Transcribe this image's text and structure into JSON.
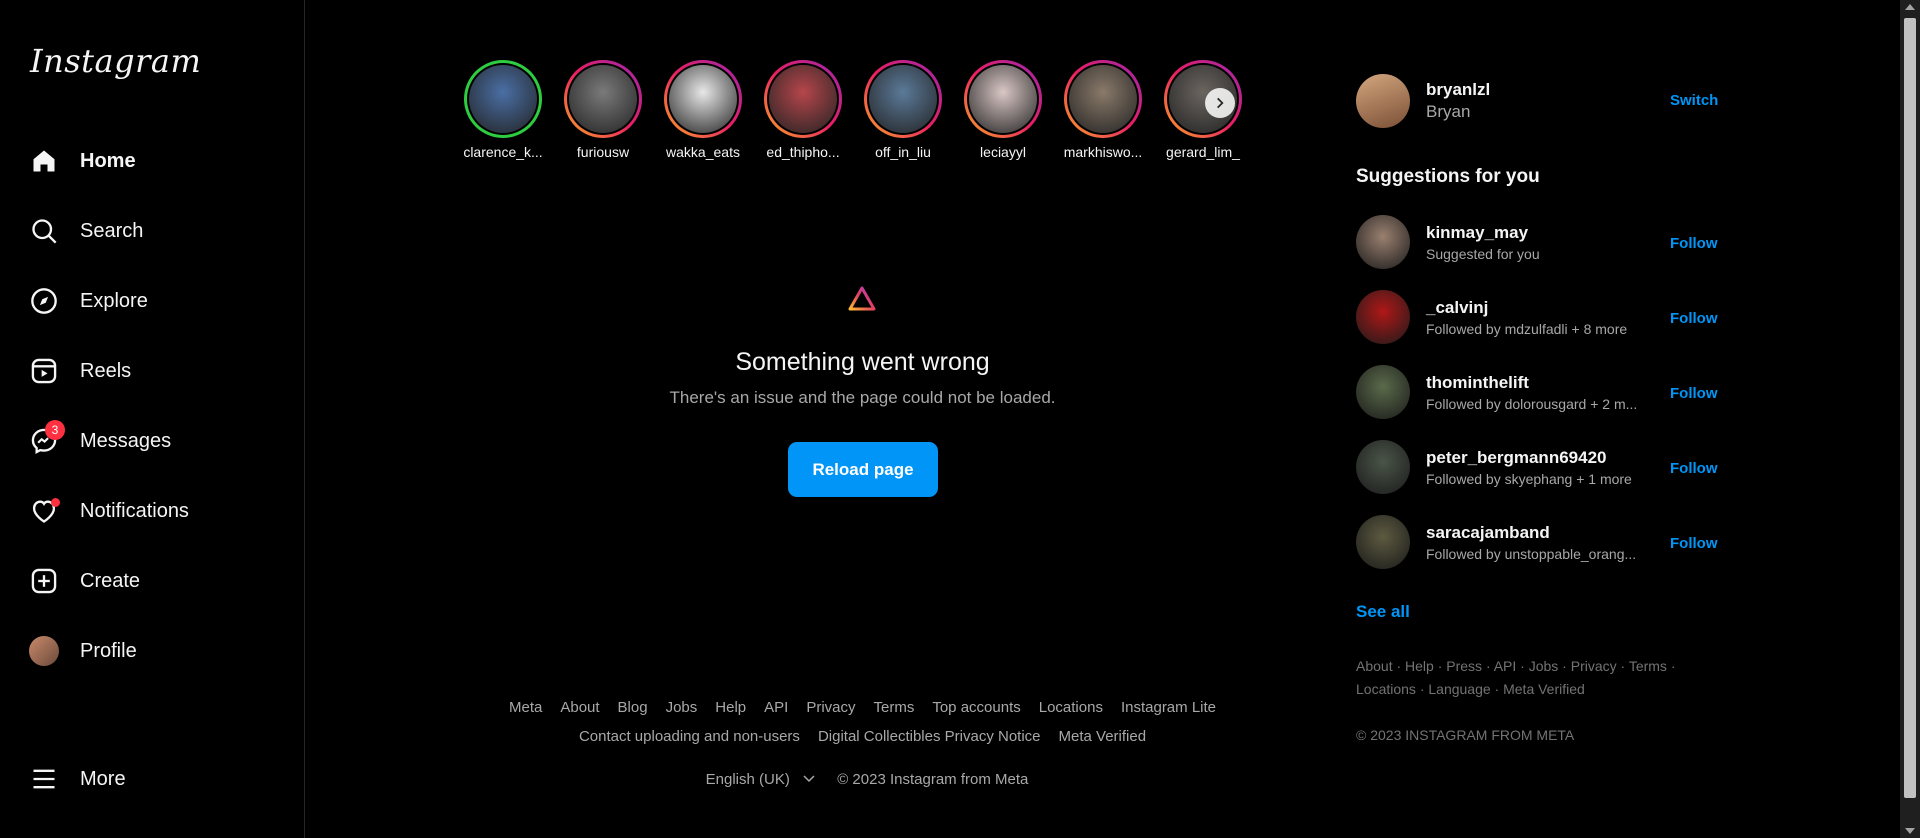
{
  "app": {
    "logo": "Instagram"
  },
  "sidebar": {
    "items": [
      {
        "label": "Home",
        "icon": "home-icon",
        "active": true
      },
      {
        "label": "Search",
        "icon": "search-icon"
      },
      {
        "label": "Explore",
        "icon": "compass-icon"
      },
      {
        "label": "Reels",
        "icon": "reels-icon"
      },
      {
        "label": "Messages",
        "icon": "messenger-icon",
        "badge": "3"
      },
      {
        "label": "Notifications",
        "icon": "heart-icon",
        "dot": true
      },
      {
        "label": "Create",
        "icon": "plus-square-icon"
      },
      {
        "label": "Profile",
        "icon": "avatar"
      }
    ],
    "more": {
      "label": "More",
      "icon": "hamburger-icon"
    }
  },
  "stories": [
    {
      "name": "clarence_k...",
      "color": "#4a6fa5",
      "seen_ring": "green"
    },
    {
      "name": "furiousw",
      "color": "#7a7a7a"
    },
    {
      "name": "wakka_eats",
      "color": "#e8e8e8"
    },
    {
      "name": "ed_thipho...",
      "color": "#b5464b"
    },
    {
      "name": "off_in_liu",
      "color": "#5b7a99"
    },
    {
      "name": "leciayyl",
      "color": "#d9c7c5"
    },
    {
      "name": "markhiswo...",
      "color": "#8a7a6a"
    },
    {
      "name": "gerard_lim_",
      "color": "#6b6560"
    }
  ],
  "error": {
    "title": "Something went wrong",
    "subtitle": "There's an issue and the page could not be loaded.",
    "button": "Reload page"
  },
  "footer": {
    "row1": [
      "Meta",
      "About",
      "Blog",
      "Jobs",
      "Help",
      "API",
      "Privacy",
      "Terms",
      "Top accounts",
      "Locations",
      "Instagram Lite"
    ],
    "row2": [
      "Contact uploading and non-users",
      "Digital Collectibles Privacy Notice",
      "Meta Verified"
    ],
    "language": "English (UK)",
    "copyright": "© 2023 Instagram from Meta"
  },
  "account": {
    "username": "bryanlzl",
    "name": "Bryan",
    "switch": "Switch"
  },
  "suggestions": {
    "title": "Suggestions for you",
    "follow_label": "Follow",
    "items": [
      {
        "username": "kinmay_may",
        "sub": "Suggested for you",
        "color": "#9a8070"
      },
      {
        "username": "_calvinj",
        "sub": "Followed by mdzulfadli + 8 more",
        "color": "#b01818"
      },
      {
        "username": "thominthelift",
        "sub": "Followed by dolorousgard + 2 m...",
        "color": "#5a6a4a"
      },
      {
        "username": "peter_bergmann69420",
        "sub": "Followed by skyephang + 1 more",
        "color": "#4a5548"
      },
      {
        "username": "saracajamband",
        "sub": "Followed by unstoppable_orang...",
        "color": "#5d5a40"
      }
    ],
    "see_all": "See all"
  },
  "right_links": {
    "row1": "About · Help · Press · API · Jobs · Privacy · Terms ·",
    "row2": "Locations · Language · Meta Verified",
    "copyright": "© 2023 INSTAGRAM FROM META"
  },
  "colors": {
    "accent": "#0095f6",
    "badge": "#ff3040",
    "muted": "#a8a8a8"
  }
}
